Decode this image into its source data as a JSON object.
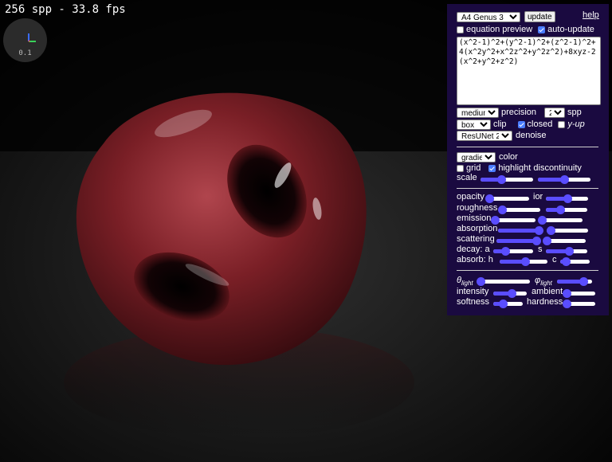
{
  "status": {
    "text": "256 spp - 33.8 fps"
  },
  "gizmo": {
    "scale_label": "0.1"
  },
  "panel": {
    "preset": {
      "selected": "A4 Genus 3"
    },
    "update_label": "update",
    "help_label": "help",
    "equation_preview": {
      "label": "equation preview",
      "checked": false
    },
    "auto_update": {
      "label": "auto-update",
      "checked": true
    },
    "equation_text": "(x^2-1)^2+(y^2-1)^2+(z^2-1)^2+4(x^2y^2+x^2z^2+y^2z^2)+8xyz-2(x^2+y^2+z^2)",
    "precision": {
      "selected": "medium",
      "label": "precision"
    },
    "spp": {
      "selected": "2⁸",
      "label": "spp"
    },
    "clip": {
      "selected": "box",
      "label": "clip"
    },
    "closed": {
      "label": "closed",
      "checked": true
    },
    "y_up": {
      "label": "y-up",
      "checked": false
    },
    "denoise": {
      "selected": "ResUNet 2",
      "label": "denoise"
    },
    "color_mode": {
      "selected": "gradient",
      "label": "color"
    },
    "grid": {
      "label": "grid",
      "checked": false
    },
    "highlight_discontinuity": {
      "label": "highlight discontinuity",
      "checked": true
    },
    "scale": {
      "label": "scale",
      "values": [
        0.4,
        0.5
      ]
    },
    "material": {
      "opacity": {
        "label": "opacity",
        "value": 0.03
      },
      "ior": {
        "label": "ior",
        "value": 0.5
      },
      "roughness": {
        "label": "roughness",
        "value": 0.04
      },
      "roughness_2": {
        "value": 0.35
      },
      "emission": {
        "label": "emission",
        "value": 0.02
      },
      "emission_2": {
        "value": 0.02
      },
      "absorption": {
        "label": "absorption",
        "value": 0.94
      },
      "absorption_2": {
        "value": 0.1
      },
      "scattering": {
        "label": "scattering",
        "value": 0.9
      },
      "scattering_2": {
        "value": 0.02
      },
      "decay_a": {
        "label": "decay: a",
        "value": 0.3
      },
      "decay_s": {
        "label": "s",
        "value": 0.55
      },
      "absorb_h": {
        "label": "absorb: h",
        "value": 0.53
      },
      "absorb_c": {
        "label": "c",
        "value": 0.2
      }
    },
    "lighting": {
      "theta_light": {
        "symbol": "θ",
        "sub": "light",
        "value": 0.03
      },
      "phi_light": {
        "symbol": "φ",
        "sub": "light",
        "value": 0.75
      },
      "intensity": {
        "label": "intensity",
        "value": 0.55
      },
      "ambient": {
        "label": "ambient",
        "value": 0.03
      },
      "softness": {
        "label": "softness",
        "value": 0.33
      },
      "hardness": {
        "label": "hardness",
        "value": 0.02
      }
    }
  },
  "colors": {
    "panel_bg": "#1a0a40",
    "accent": "#5a4dff",
    "surface": "#7a1f26"
  }
}
